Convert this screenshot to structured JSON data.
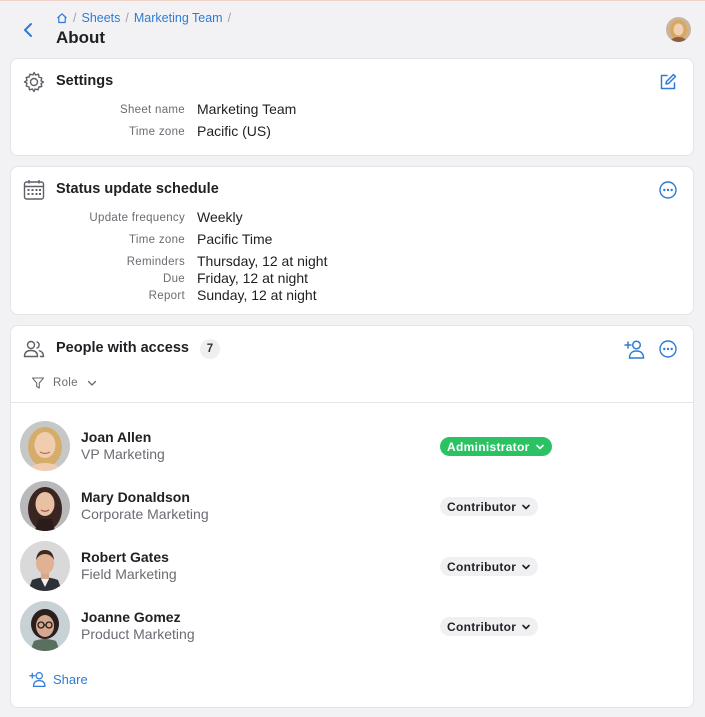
{
  "breadcrumb": {
    "home": "home",
    "items": [
      "Sheets",
      "Marketing Team"
    ]
  },
  "page": {
    "title": "About"
  },
  "settings": {
    "title": "Settings",
    "fields": [
      {
        "key": "Sheet name",
        "value": "Marketing Team"
      },
      {
        "key": "Time zone",
        "value": "Pacific (US)"
      }
    ]
  },
  "schedule": {
    "title": "Status update schedule",
    "frequency": {
      "key": "Update frequency",
      "value": "Weekly"
    },
    "timezone": {
      "key": "Time zone",
      "value": "Pacific Time"
    },
    "reminders": {
      "key": "Reminders",
      "value": "Thursday, 12 at night"
    },
    "due": {
      "key": "Due",
      "value": "Friday, 12 at night"
    },
    "report": {
      "key": "Report",
      "value": "Sunday, 12 at night"
    }
  },
  "people": {
    "title": "People with access",
    "count": "7",
    "filter_label": "Role",
    "share_label": "Share",
    "list": [
      {
        "name": "Joan Allen",
        "dept": "VP Marketing",
        "role": "Administrator"
      },
      {
        "name": "Mary Donaldson",
        "dept": "Corporate Marketing",
        "role": "Contributor"
      },
      {
        "name": "Robert Gates",
        "dept": "Field Marketing",
        "role": "Contributor"
      },
      {
        "name": "Joanne Gomez",
        "dept": "Product Marketing",
        "role": "Contributor"
      }
    ]
  },
  "colors": {
    "accent": "#2f7bd6",
    "admin_badge": "#2bc264",
    "background": "#f2f2f4"
  },
  "icons": [
    "chevron-left-icon",
    "home-icon",
    "gear-icon",
    "edit-icon",
    "calendar-icon",
    "more-icon",
    "people-icon",
    "add-person-icon",
    "filter-icon",
    "chevron-down-icon"
  ]
}
